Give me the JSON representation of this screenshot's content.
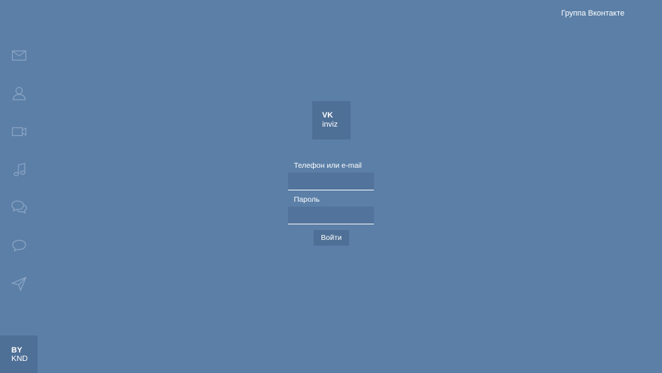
{
  "header": {
    "group_link": "Группа Вконтакте"
  },
  "sidebar": {
    "icons": [
      "mail-icon",
      "friends-icon",
      "video-icon",
      "music-icon",
      "chats-icon",
      "comment-icon",
      "send-icon"
    ]
  },
  "author": {
    "line1": "BY",
    "line2": "KND"
  },
  "logo": {
    "line1": "VK",
    "line2": "inviz"
  },
  "form": {
    "login_label": "Телефон или e-mail",
    "login_value": "",
    "password_label": "Пароль",
    "password_value": "",
    "submit_label": "Войти"
  },
  "colors": {
    "background": "#5b7fa7",
    "panel": "#4e6f96",
    "input": "#52739b",
    "icon": "#8aa4c4"
  }
}
